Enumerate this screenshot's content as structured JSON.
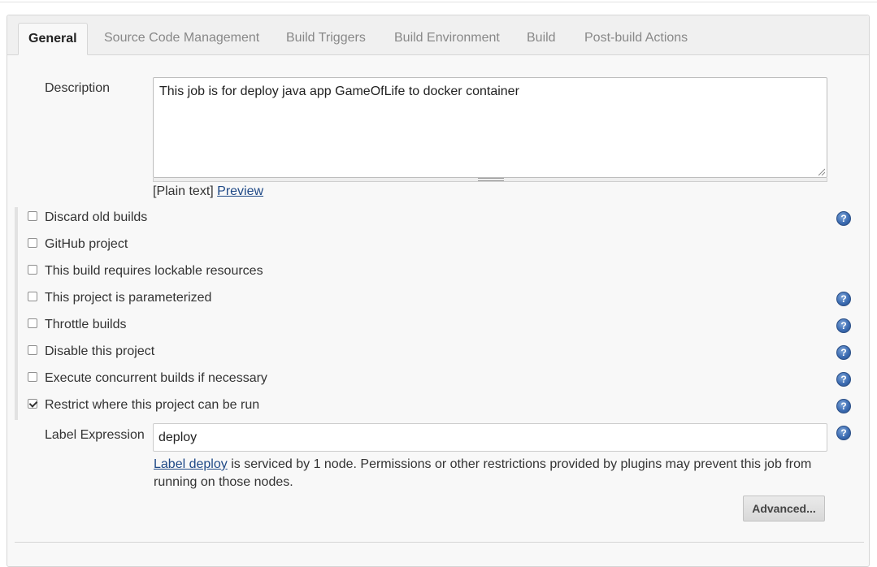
{
  "tabs": [
    {
      "label": "General",
      "active": true
    },
    {
      "label": "Source Code Management",
      "active": false
    },
    {
      "label": "Build Triggers",
      "active": false
    },
    {
      "label": "Build Environment",
      "active": false
    },
    {
      "label": "Build",
      "active": false
    },
    {
      "label": "Post-build Actions",
      "active": false
    }
  ],
  "description": {
    "label": "Description",
    "value": "This job is for deploy java app GameOfLife to docker container",
    "format_note": "[Plain text]",
    "preview_link": "Preview"
  },
  "options": [
    {
      "label": "Discard old builds",
      "checked": false,
      "help": true
    },
    {
      "label": "GitHub project",
      "checked": false,
      "help": false
    },
    {
      "label": "This build requires lockable resources",
      "checked": false,
      "help": false
    },
    {
      "label": "This project is parameterized",
      "checked": false,
      "help": true
    },
    {
      "label": "Throttle builds",
      "checked": false,
      "help": true
    },
    {
      "label": "Disable this project",
      "checked": false,
      "help": true
    },
    {
      "label": "Execute concurrent builds if necessary",
      "checked": false,
      "help": true
    },
    {
      "label": "Restrict where this project can be run",
      "checked": true,
      "help": true
    }
  ],
  "label_expression": {
    "label": "Label Expression",
    "value": "deploy",
    "info_link": "Label deploy",
    "info_text": " is serviced by 1 node. Permissions or other restrictions provided by plugins may prevent this job from running on those nodes.",
    "advanced_button": "Advanced..."
  },
  "help_icon_glyph": "?",
  "colors": {
    "link": "#204a87",
    "help_icon": "#3d6db3",
    "panel_bg": "#f8f8f8"
  }
}
